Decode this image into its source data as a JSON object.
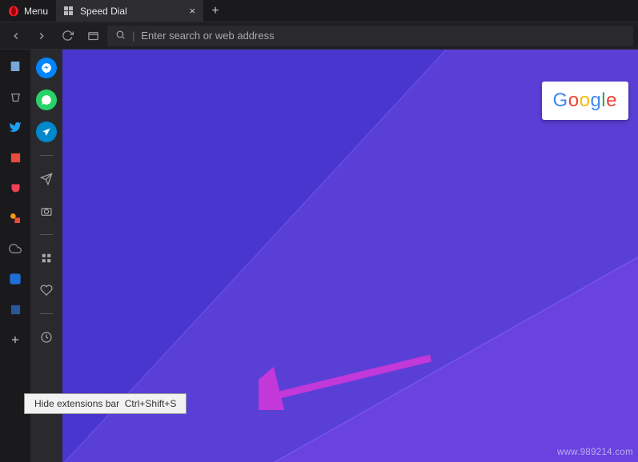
{
  "header": {
    "menu_label": "Menu",
    "tab": {
      "title": "Speed Dial"
    }
  },
  "toolbar": {
    "search_placeholder": "Enter search or web address"
  },
  "ext_bar": {
    "items": [
      {
        "name": "bookmark-icon"
      },
      {
        "name": "trash-icon"
      },
      {
        "name": "twitter-icon"
      },
      {
        "name": "office-icon"
      },
      {
        "name": "pocket-icon"
      },
      {
        "name": "shapes-icon"
      },
      {
        "name": "cloud-icon"
      },
      {
        "name": "grammarly-icon"
      },
      {
        "name": "word-icon"
      },
      {
        "name": "add-icon"
      }
    ]
  },
  "sidebar": {
    "items": [
      {
        "name": "messenger-icon"
      },
      {
        "name": "whatsapp-icon"
      },
      {
        "name": "telegram-icon"
      },
      {
        "name": "separator"
      },
      {
        "name": "send-icon"
      },
      {
        "name": "camera-icon"
      },
      {
        "name": "separator"
      },
      {
        "name": "apps-icon"
      },
      {
        "name": "heart-icon"
      },
      {
        "name": "separator"
      },
      {
        "name": "history-icon"
      }
    ]
  },
  "speed_dial": {
    "tile_label": "Google"
  },
  "tooltip": {
    "text": "Hide extensions bar",
    "shortcut": "Ctrl+Shift+S"
  },
  "watermark": "www.989214.com"
}
